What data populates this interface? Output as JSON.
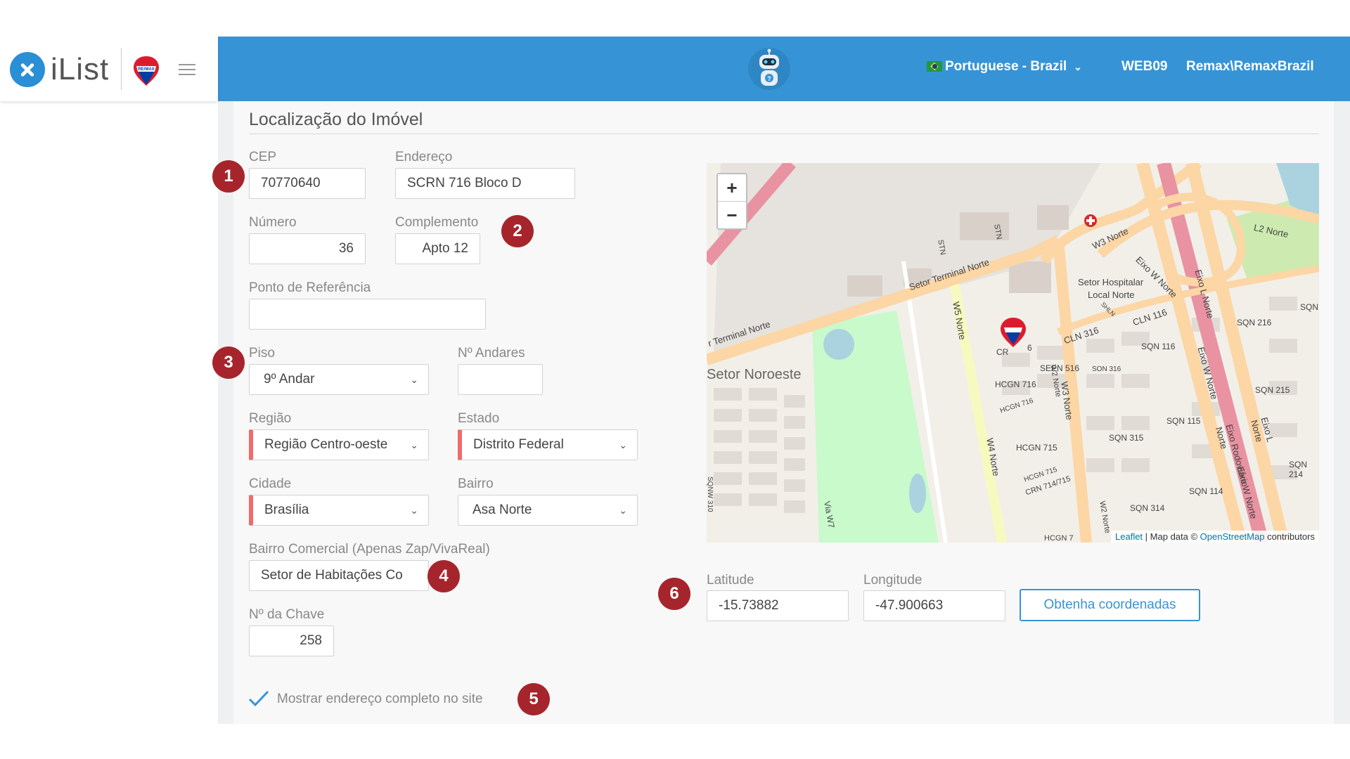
{
  "header": {
    "brand": "iList",
    "language": "Portuguese - Brazil",
    "station": "WEB09",
    "user": "Remax\\RemaxBrazil"
  },
  "section": {
    "title": "Localização do Imóvel"
  },
  "form": {
    "cep": {
      "label": "CEP",
      "value": "70770640"
    },
    "endereco": {
      "label": "Endereço",
      "value": "SCRN 716 Bloco D"
    },
    "numero": {
      "label": "Número",
      "value": "36"
    },
    "complemento": {
      "label": "Complemento",
      "value": "Apto 12"
    },
    "ponto_referencia": {
      "label": "Ponto de Referência",
      "value": ""
    },
    "piso": {
      "label": "Piso",
      "value": "9º Andar"
    },
    "n_andares": {
      "label": "Nº Andares",
      "value": ""
    },
    "regiao": {
      "label": "Região",
      "value": "Região Centro-oeste"
    },
    "estado": {
      "label": "Estado",
      "value": "Distrito Federal"
    },
    "cidade": {
      "label": "Cidade",
      "value": "Brasília"
    },
    "bairro": {
      "label": "Bairro",
      "value": "Asa Norte"
    },
    "bairro_comercial": {
      "label": "Bairro Comercial (Apenas Zap/VivaReal)",
      "value": "Setor de Habitações Co"
    },
    "n_chave": {
      "label": "Nº da Chave",
      "value": "258"
    },
    "mostrar_endereco": {
      "label": "Mostrar endereço completo no site",
      "checked": true
    },
    "latitude": {
      "label": "Latitude",
      "value": "-15.73882"
    },
    "longitude": {
      "label": "Longitude",
      "value": "-47.900663"
    },
    "obter_coordenadas": "Obtenha coordenadas"
  },
  "map": {
    "zoom_in": "+",
    "zoom_out": "−",
    "labels": {
      "setor_noroeste": "Setor Noroeste",
      "terminal_norte": "r Terminal Norte",
      "setor_terminal_norte": "Setor Terminal Norte",
      "setor_hospitalar_1": "Setor Hospitalar",
      "setor_hospitalar_2": "Local Norte",
      "w3_norte_a": "W3 Norte",
      "w3_norte_b": "W3 Norte",
      "w5_norte": "W5 Norte",
      "w4_norte": "W4 Norte",
      "eixo_w_norte": "Eixo W Norte",
      "eixo_l_norte_a": "Eixo L Norte",
      "eixo_l_norte_b": "Eixo L Norte",
      "eixo_w_norte_b": "Eixo W Norte",
      "eixo_w_norte_c": "Eixo W Norte",
      "eixo_rodoviario": "Eixo Rodoviário Norte",
      "l2_norte": "L2 Norte",
      "cln_316": "CLN 316",
      "cln_116": "CLN 116",
      "sepn_516": "SEPN 516",
      "son_316": "SON 316",
      "hcgn_716_a": "HCGN 716",
      "hcgn_716_b": "HCGN 716",
      "hcgn_715_a": "HCGN 715",
      "hcgn_715_b": "HCGN 715",
      "crn_714": "CRN 714/715",
      "sqn_216": "SQN 216",
      "sqn_116": "SQN 116",
      "sqn_215": "SQN 215",
      "sqn_115": "SQN 115",
      "sqn_315": "SQN 315",
      "sqn_214": "SQN 214",
      "sqn_114": "SQN 114",
      "sqn_314": "SQN 314",
      "sqn_edge": "SQN",
      "stn": "STN",
      "stn_b": "STN",
      "shln": "SHLN",
      "via_w7": "Via W7",
      "sqnw": "SQNW 310",
      "hcgn_bottom": "HCGN 7",
      "w2_norte_a": "W2 Norte",
      "w2_norte_b": "W2 Norte",
      "crn_partial": "CR",
      "partial_6": "6"
    },
    "attribution": {
      "leaflet": "Leaflet",
      "middle": " | Map data © ",
      "osm": "OpenStreetMap",
      "suffix": " contributors"
    }
  },
  "badges": [
    "1",
    "2",
    "3",
    "4",
    "5",
    "6"
  ]
}
